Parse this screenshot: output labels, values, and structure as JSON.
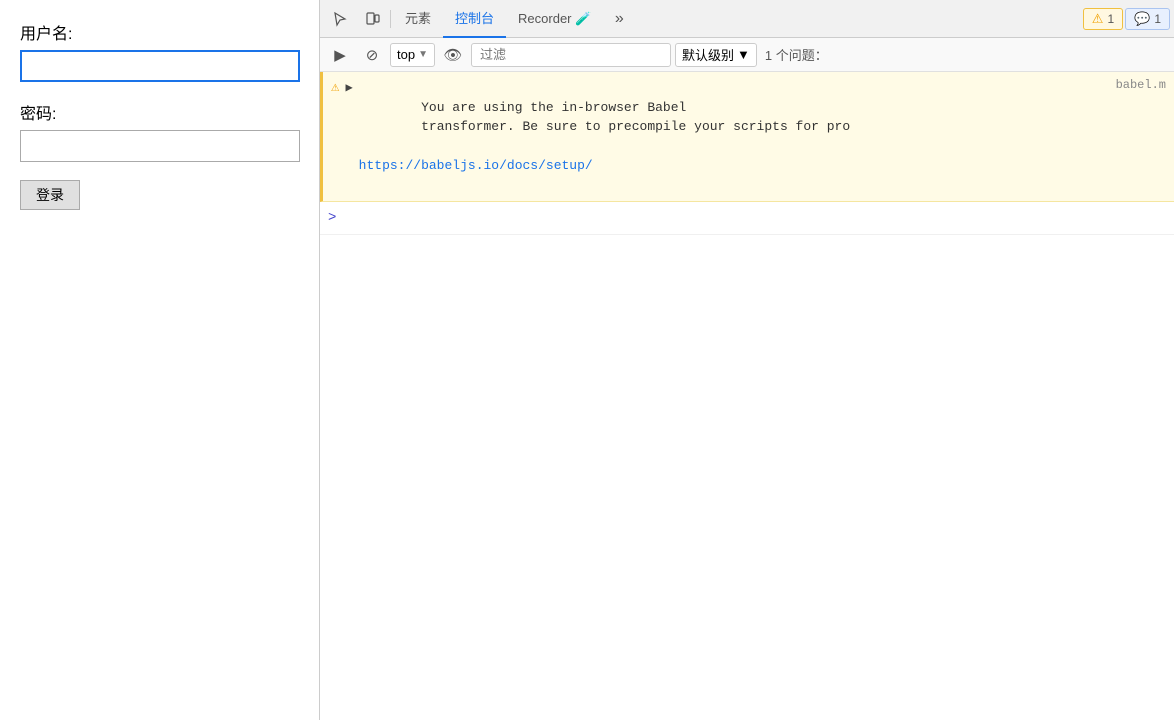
{
  "leftPanel": {
    "usernameLabel": "用户名:",
    "usernamePlaceholder": "",
    "passwordLabel": "密码:",
    "passwordPlaceholder": "",
    "loginButton": "登录"
  },
  "devtools": {
    "tabs": [
      {
        "id": "cursor",
        "label": "⬡",
        "icon": true
      },
      {
        "id": "device",
        "label": "⬢",
        "icon": true
      },
      {
        "id": "elements",
        "label": "元素",
        "active": false
      },
      {
        "id": "console",
        "label": "控制台",
        "active": true
      },
      {
        "id": "recorder",
        "label": "Recorder 🧪",
        "active": false
      },
      {
        "id": "more",
        "label": "»",
        "icon": true
      }
    ],
    "warningBadge": {
      "icon": "⚠",
      "count": "1"
    },
    "messageBadge": {
      "icon": "💬",
      "count": "1"
    },
    "toolbar": {
      "playButton": "▶",
      "blockButton": "⊘",
      "topDropdown": "top",
      "eyeButton": "👁",
      "filterPlaceholder": "过滤",
      "levelDropdown": "默认级别",
      "issuesLabel": "1 个问题："
    },
    "console": {
      "warningMessage": "You are using the in-browser Babel\ntransformer. Be sure to precompile your scripts for pro",
      "warningSource": "babel.m",
      "warningLink": "https://babeljs.io/docs/setup/",
      "promptArrow": ">"
    }
  }
}
